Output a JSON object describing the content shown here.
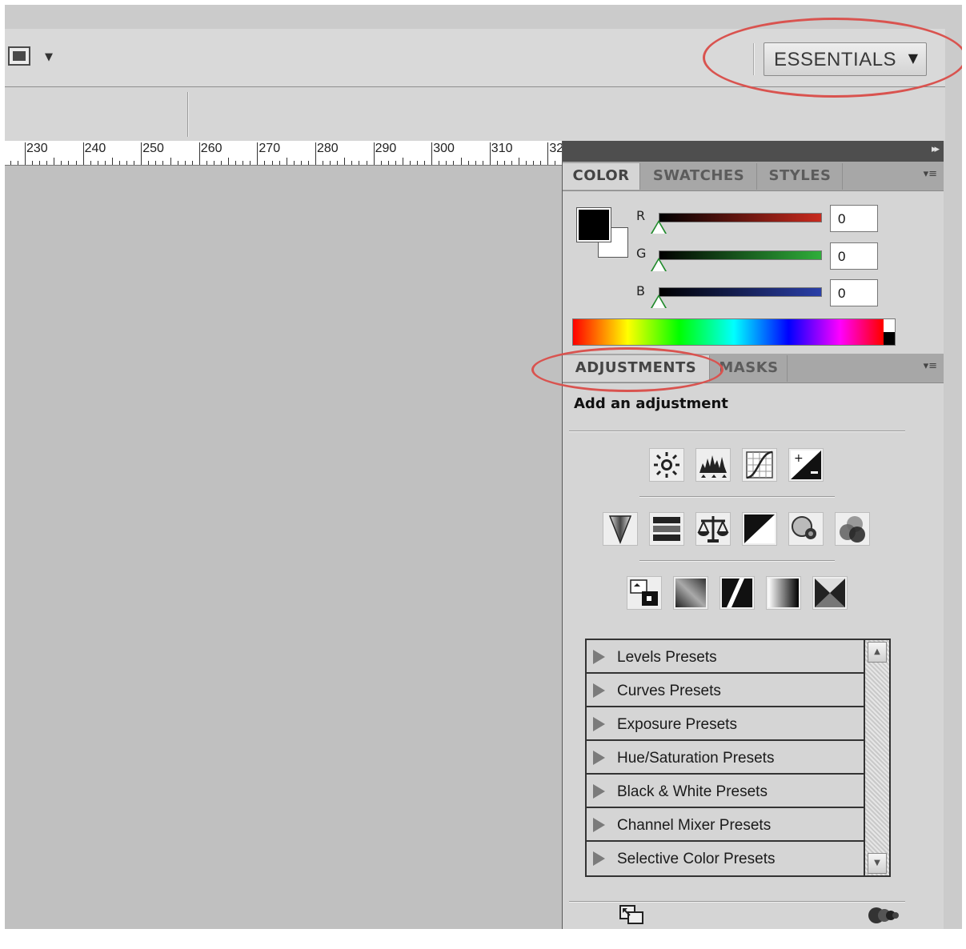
{
  "app_bar": {
    "screen_mode_icon": "screen-mode-icon",
    "workspace_label": "ESSENTIALS",
    "workspace_caret": "▼",
    "screen_caret": "▼"
  },
  "ruler": {
    "labels": [
      "230",
      "240",
      "250",
      "260",
      "270",
      "280",
      "290",
      "300",
      "310",
      "32"
    ]
  },
  "dock": {
    "collapse_glyph": "▸▸",
    "panel_menu_glyph": "▾≡"
  },
  "color_panel": {
    "tabs": [
      "COLOR",
      "SWATCHES",
      "STYLES"
    ],
    "active_tab": "COLOR",
    "channels": [
      {
        "label": "R",
        "value": "0",
        "color": "#c82a1e"
      },
      {
        "label": "G",
        "value": "0",
        "color": "#2fae3a"
      },
      {
        "label": "B",
        "value": "0",
        "color": "#2a3fa8"
      }
    ],
    "foreground_color": "#000000",
    "background_color": "#ffffff"
  },
  "adjustments_panel": {
    "tabs": [
      "ADJUSTMENTS",
      "MASKS"
    ],
    "active_tab": "ADJUSTMENTS",
    "title": "Add an adjustment",
    "icon_rows": [
      [
        "brightness-contrast-icon",
        "levels-icon",
        "curves-icon",
        "exposure-icon"
      ],
      [
        "vibrance-icon",
        "hue-saturation-icon",
        "color-balance-icon",
        "black-white-icon",
        "photo-filter-icon",
        "channel-mixer-icon"
      ],
      [
        "invert-icon",
        "posterize-icon",
        "threshold-icon",
        "gradient-map-icon",
        "selective-color-icon"
      ]
    ],
    "presets": [
      "Levels Presets",
      "Curves Presets",
      "Exposure Presets",
      "Hue/Saturation Presets",
      "Black & White Presets",
      "Channel Mixer Presets",
      "Selective Color Presets"
    ],
    "footer_icons": [
      "expand-view-icon",
      "clip-to-layer-icon"
    ]
  },
  "highlight_color": "#d9534f"
}
